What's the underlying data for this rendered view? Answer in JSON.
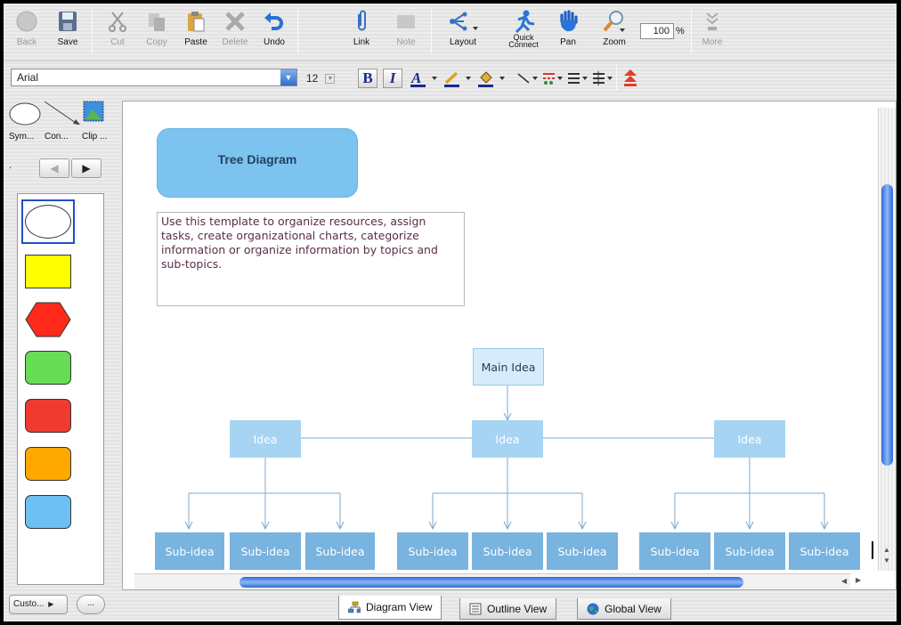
{
  "toolbar": {
    "back": "Back",
    "save": "Save",
    "cut": "Cut",
    "copy": "Copy",
    "paste": "Paste",
    "delete": "Delete",
    "undo": "Undo",
    "link": "Link",
    "note": "Note",
    "layout": "Layout",
    "quick_connect_1": "Quick",
    "quick_connect_2": "Connect",
    "pan": "Pan",
    "zoom": "Zoom",
    "zoom_value": "100",
    "zoom_unit": "%",
    "more": "More"
  },
  "format_bar": {
    "font_family": "Arial",
    "font_size": "12",
    "bold": "B",
    "italic": "I"
  },
  "palette": {
    "tabs": [
      "Sym...",
      "Con...",
      "Clip ..."
    ],
    "nav_dot": ".",
    "custom_button": "Custo...",
    "more_button": "...",
    "shape_colors": {
      "yellow": "#ffff00",
      "red_hex": "#ff2a1a",
      "green": "#66dd55",
      "red": "#f03a30",
      "orange": "#ffa800",
      "blue": "#6cc0f2"
    }
  },
  "diagram": {
    "title": "Tree Diagram",
    "description": "Use this template to organize resources, assign tasks, create organizational charts, categorize information or organize information by topics and sub-topics.",
    "main_idea": "Main Idea",
    "ideas": [
      "Idea",
      "Idea",
      "Idea"
    ],
    "sub_ideas": [
      "Sub-idea",
      "Sub-idea",
      "Sub-idea",
      "Sub-idea",
      "Sub-idea",
      "Sub-idea",
      "Sub-idea",
      "Sub-idea",
      "Sub-idea"
    ]
  },
  "tabs": {
    "diagram_view": "Diagram View",
    "outline_view": "Outline View",
    "global_view": "Global View"
  }
}
